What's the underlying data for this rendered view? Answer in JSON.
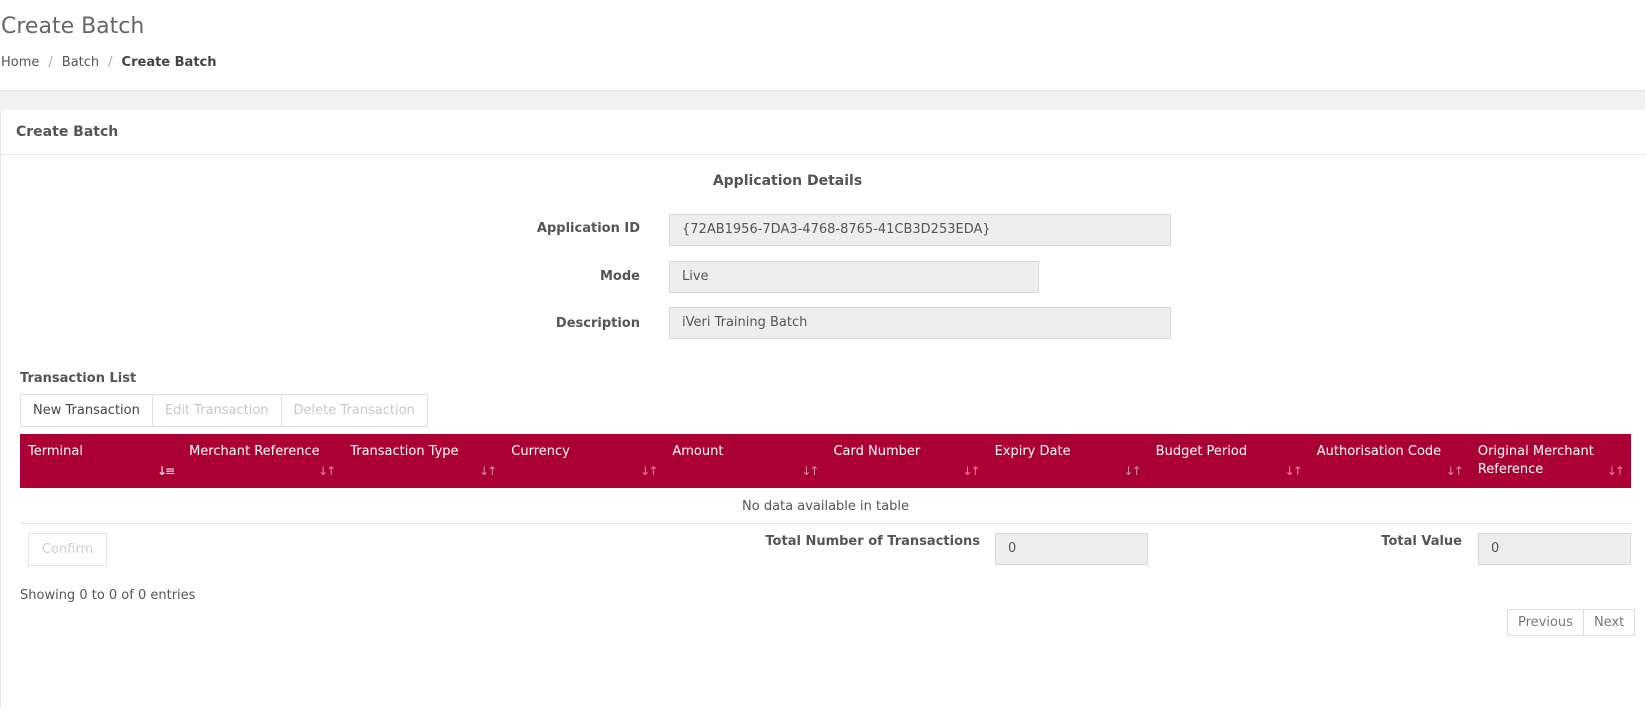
{
  "header": {
    "title": "Create Batch",
    "breadcrumb": [
      "Home",
      "Batch",
      "Create Batch"
    ]
  },
  "card": {
    "title": "Create Batch",
    "section_heading": "Application Details",
    "fields": {
      "application_id": {
        "label": "Application ID",
        "value": "{72AB1956-7DA3-4768-8765-41CB3D253EDA}"
      },
      "mode": {
        "label": "Mode",
        "value": "Live"
      },
      "description": {
        "label": "Description",
        "value": "iVeri Training Batch"
      }
    }
  },
  "transaction_list": {
    "label": "Transaction List",
    "buttons": {
      "new": "New Transaction",
      "edit": "Edit Transaction",
      "delete": "Delete Transaction"
    },
    "columns": [
      "Terminal",
      "Merchant Reference",
      "Transaction Type",
      "Currency",
      "Amount",
      "Card Number",
      "Expiry Date",
      "Budget Period",
      "Authorisation Code",
      "Original Merchant Reference"
    ],
    "empty_message": "No data available in table",
    "confirm_label": "Confirm",
    "total_transactions": {
      "label": "Total Number of Transactions",
      "value": "0"
    },
    "total_value": {
      "label": "Total Value",
      "value": "0"
    },
    "showing": "Showing 0 to 0 of 0 entries",
    "pagination": {
      "previous": "Previous",
      "next": "Next"
    }
  },
  "colors": {
    "table_header": "#ab0033"
  }
}
